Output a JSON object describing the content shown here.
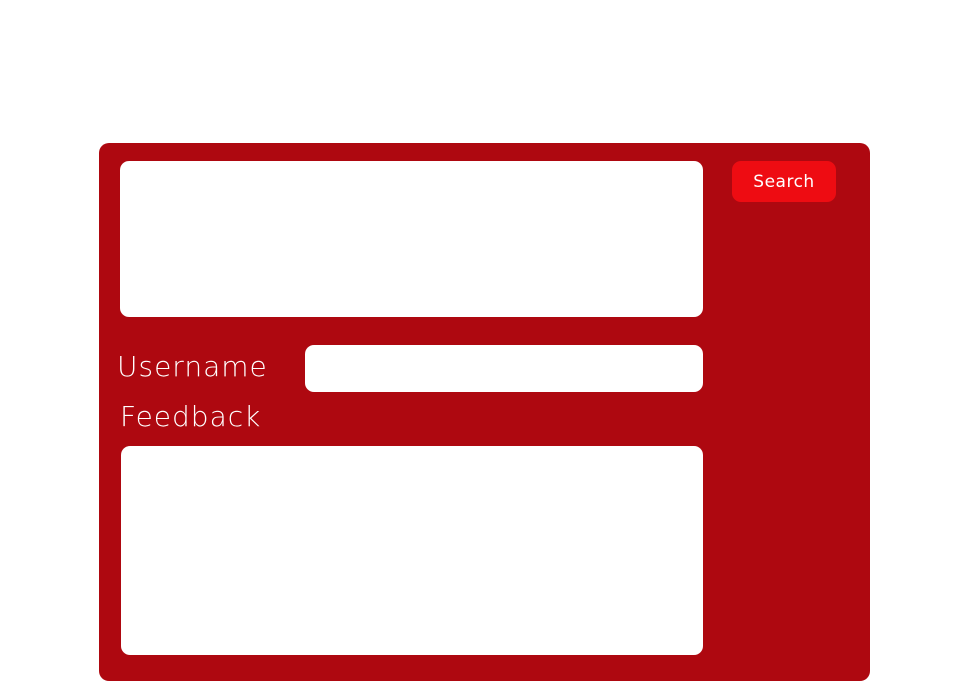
{
  "colors": {
    "panel_background": "#ae0810",
    "button_background": "#ee0c12",
    "field_background": "#ffffff",
    "label_text": "#ffffff"
  },
  "search": {
    "input_value": "",
    "button_label": "Search"
  },
  "username": {
    "label": "Username",
    "value": ""
  },
  "feedback": {
    "label": "Feedback",
    "value": ""
  }
}
